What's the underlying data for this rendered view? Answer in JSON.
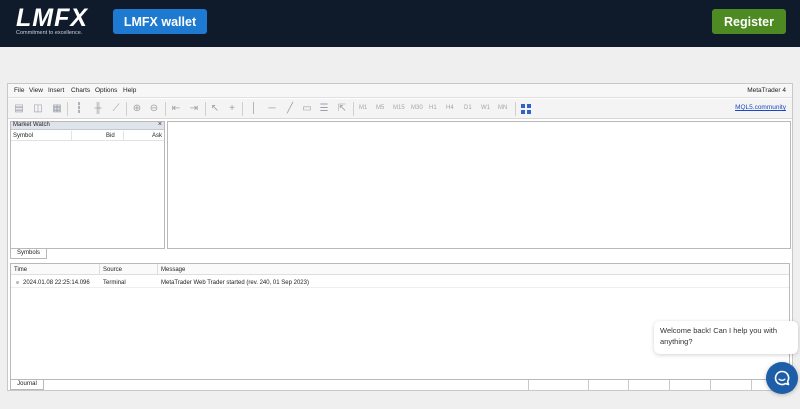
{
  "header": {
    "logo_text": "LMFX",
    "logo_tagline": "Commitment to excellence.",
    "wallet_button": "LMFX wallet",
    "register_button": "Register"
  },
  "menu": {
    "items": [
      "File",
      "View",
      "Insert",
      "Charts",
      "Options",
      "Help"
    ],
    "app_title": "MetaTrader 4"
  },
  "toolbar": {
    "timeframes": [
      "M1",
      "M5",
      "M15",
      "M30",
      "H1",
      "H4",
      "D1",
      "W1",
      "MN"
    ],
    "community_link": "MQL5.community"
  },
  "market_watch": {
    "title": "Market Watch",
    "close_symbol": "×",
    "columns": [
      "Symbol",
      "Bid",
      "Ask"
    ],
    "tab_label": "Symbols"
  },
  "journal": {
    "columns": [
      "Time",
      "Source",
      "Message"
    ],
    "rows": [
      {
        "time": "2024.01.08 22:25:14.096",
        "source": "Terminal",
        "message": "MetaTrader Web Trader started (rev. 240, 01 Sep 2023)"
      }
    ],
    "tab_label": "Journal"
  },
  "chat": {
    "message": "Welcome back! Can I help you with anything?"
  },
  "colors": {
    "header_bg": "#0f1a2b",
    "wallet_btn": "#1d7ad0",
    "register_btn": "#4d8a22",
    "chat_btn": "#1e5ea8",
    "link": "#1a47c4"
  }
}
